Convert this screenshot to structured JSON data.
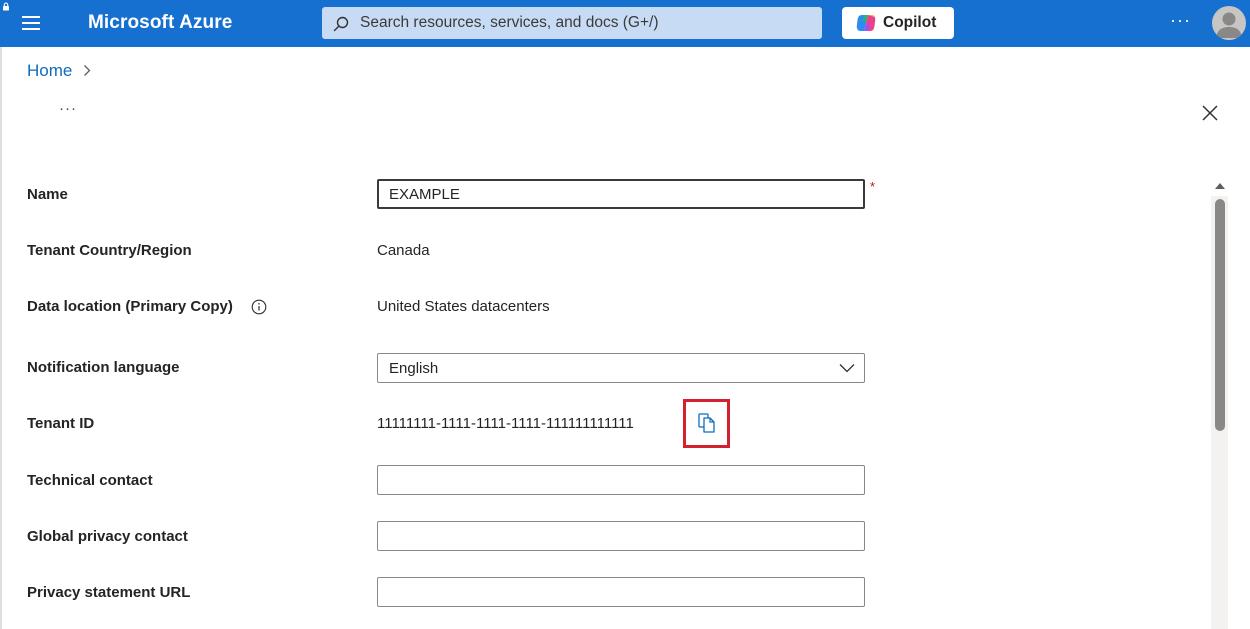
{
  "header": {
    "brand": "Microsoft Azure",
    "search_placeholder": "Search resources, services, and docs (G+/)",
    "copilot_label": "Copilot",
    "more_label": "···",
    "accent_color": "#1570d0"
  },
  "breadcrumb": {
    "home": "Home"
  },
  "panel": {
    "menu_label": "···"
  },
  "form": {
    "name": {
      "label": "Name",
      "value": "EXAMPLE",
      "required_mark": "*"
    },
    "tenant_region": {
      "label": "Tenant Country/Region",
      "value": "Canada"
    },
    "data_location": {
      "label": "Data location (Primary Copy)",
      "value": "United States datacenters"
    },
    "notification_language": {
      "label": "Notification language",
      "value": "English"
    },
    "tenant_id": {
      "label": "Tenant ID",
      "value": "11111111-1111-1111-1111-111111111111"
    },
    "technical_contact": {
      "label": "Technical contact",
      "value": ""
    },
    "global_privacy_contact": {
      "label": "Global privacy contact",
      "value": ""
    },
    "privacy_statement_url": {
      "label": "Privacy statement URL",
      "value": ""
    }
  },
  "icons": {
    "menu": "hamburger-icon",
    "search": "search-icon",
    "copilot": "copilot-logo-icon",
    "chevron": "chevron-right-icon",
    "close": "close-icon",
    "info": "info-icon",
    "dropdown": "chevron-down-icon",
    "copy": "copy-icon",
    "highlight_color": "#d3212f"
  }
}
